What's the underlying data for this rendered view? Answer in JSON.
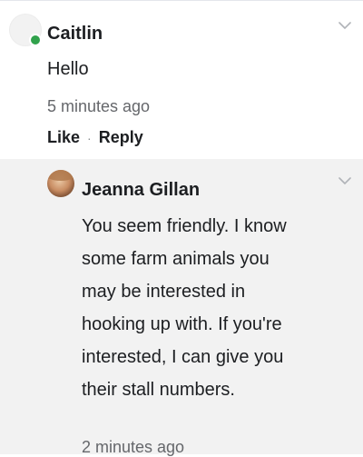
{
  "comments": [
    {
      "author": "Caitlin",
      "text": "Hello",
      "time": "5 minutes ago",
      "like_label": "Like",
      "separator": "·",
      "reply_label": "Reply",
      "online": true,
      "avatar_icon": "blank-avatar-icon"
    }
  ],
  "reply": {
    "author": "Jeanna Gillan",
    "text": "You seem friendly. I know\nsome farm animals you\nmay be interested in\nhooking up with. If you're\ninterested, I can give you\ntheir stall numbers.",
    "time": "2 minutes ago",
    "avatar_icon": "profile-photo-avatar"
  },
  "colors": {
    "online_dot": "#31a24c",
    "meta_text": "#65676b",
    "reply_background": "#f2f2f2"
  }
}
